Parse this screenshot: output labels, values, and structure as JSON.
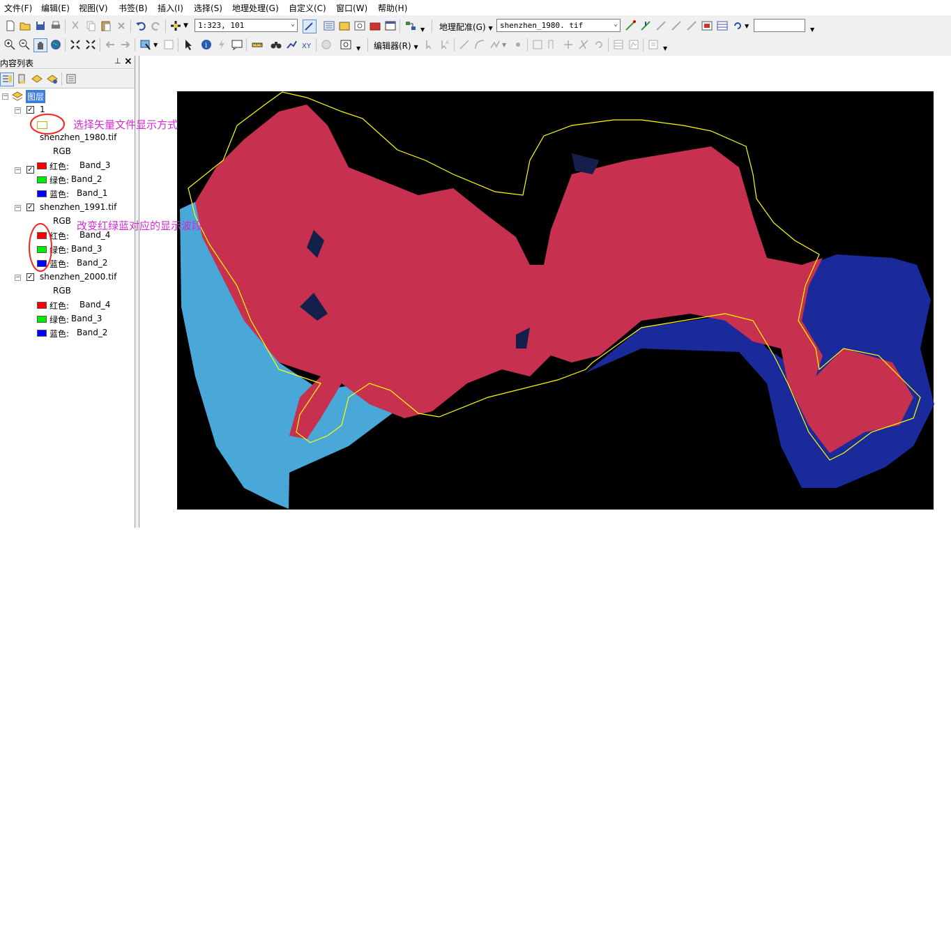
{
  "menu": [
    "文件(F)",
    "编辑(E)",
    "视图(V)",
    "书签(B)",
    "插入(I)",
    "选择(S)",
    "地理处理(G)",
    "自定义(C)",
    "窗口(W)",
    "帮助(H)"
  ],
  "toolbar": {
    "scale_value": "1:323, 101",
    "georef_label": "地理配准(G)",
    "georef_layer": "shenzhen_1980. tif",
    "editor_label": "编辑器(R)",
    "search_value": ""
  },
  "toc": {
    "title": "内容列表",
    "root_label": "图层",
    "layers": [
      {
        "name": "1",
        "checked": true,
        "legend": []
      },
      {
        "name": "shenzhen_1980.tif",
        "checked": true,
        "mode": "RGB",
        "bands": [
          {
            "label": "红色:",
            "value": "Band_3",
            "color": "#ff0000"
          },
          {
            "label": "绿色:",
            "value": "Band_2",
            "color": "#00ee00"
          },
          {
            "label": "蓝色:",
            "value": "Band_1",
            "color": "#0000ff"
          }
        ]
      },
      {
        "name": "shenzhen_1991.tif",
        "checked": true,
        "mode": "RGB",
        "bands": [
          {
            "label": "红色:",
            "value": "Band_4",
            "color": "#ff0000"
          },
          {
            "label": "绿色:",
            "value": "Band_3",
            "color": "#00ee00"
          },
          {
            "label": "蓝色:",
            "value": "Band_2",
            "color": "#0000ff"
          }
        ]
      },
      {
        "name": "shenzhen_2000.tif",
        "checked": true,
        "mode": "RGB",
        "bands": [
          {
            "label": "红色:",
            "value": "Band_4",
            "color": "#ff0000"
          },
          {
            "label": "绿色:",
            "value": "Band_3",
            "color": "#00ee00"
          },
          {
            "label": "蓝色:",
            "value": "Band_2",
            "color": "#0000ff"
          }
        ]
      }
    ]
  },
  "annotations": {
    "vector_display": "选择矢量文件显示方式",
    "band_change": "改变红绿蓝对应的显示波段"
  },
  "colors": {
    "annotation": "#d22bd2",
    "circle": "#ff2020",
    "boundary": "#ffff00",
    "land": "#c7304f",
    "sea": "#1a2a9a",
    "shallow_water": "#4aa8d8",
    "background": "#000000"
  }
}
